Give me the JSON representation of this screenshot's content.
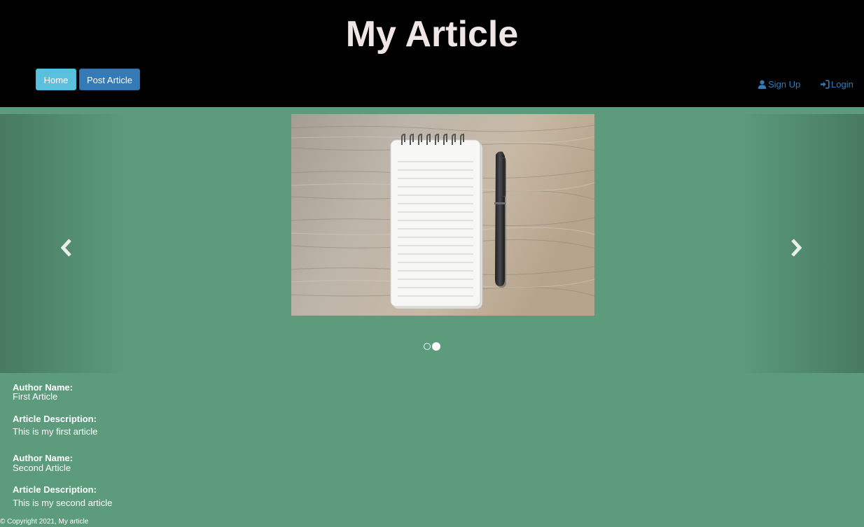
{
  "header": {
    "title": "My Article",
    "nav": {
      "home_label": "Home",
      "post_label": "Post Article"
    },
    "auth": {
      "signup_label": "Sign Up",
      "login_label": "Login",
      "signup_icon": "user-icon",
      "login_icon": "login-icon"
    }
  },
  "carousel": {
    "prev_icon": "chevron-left-icon",
    "next_icon": "chevron-right-icon",
    "indicators": [
      {
        "active": false
      },
      {
        "active": true
      }
    ]
  },
  "articles": [
    {
      "author_label": "Author Name:",
      "author": "First Article",
      "description_label": "Article Description:",
      "description": "This is my first article"
    },
    {
      "author_label": "Author Name:",
      "author": "Second Article",
      "description_label": "Article Description:",
      "description": "This is my second article"
    }
  ],
  "footer": {
    "copyright": "© Copyright 2021, My article"
  },
  "colors": {
    "page_background": "#5c9c7c",
    "header_background": "#000000",
    "title_color": "#f1e6e6",
    "home_button": "#5bc0de",
    "post_button": "#337ab7",
    "link_color": "#337ab7"
  }
}
